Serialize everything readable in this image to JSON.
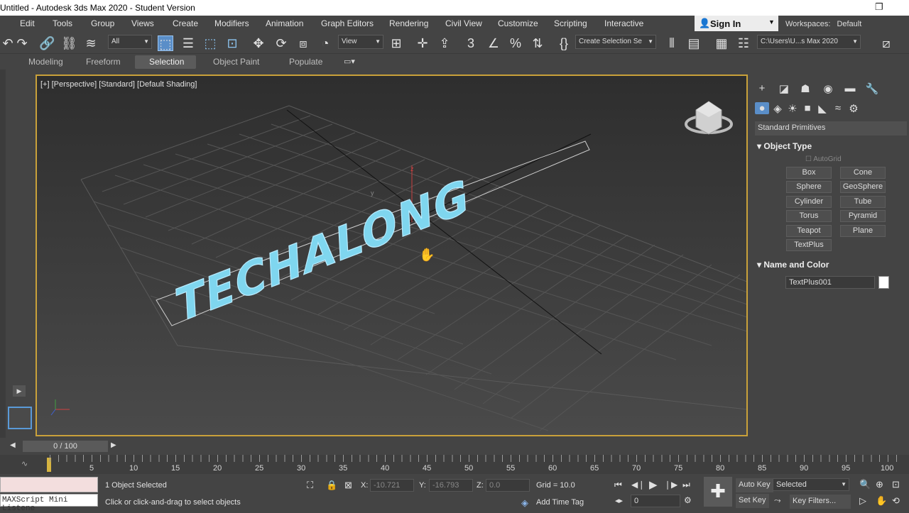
{
  "window": {
    "title": "Untitled - Autodesk 3ds Max 2020 - Student Version"
  },
  "menu": [
    "Edit",
    "Tools",
    "Group",
    "Views",
    "Create",
    "Modifiers",
    "Animation",
    "Graph Editors",
    "Rendering",
    "Civil View",
    "Customize",
    "Scripting",
    "Interactive"
  ],
  "account": {
    "signin": "Sign In",
    "workspaces_label": "Workspaces:",
    "workspace": "Default"
  },
  "toolbar": {
    "filter": "All",
    "ref_coord": "View",
    "selection_set": "Create Selection Se",
    "project_path": "C:\\Users\\U...s Max 2020"
  },
  "ribbon": {
    "tabs": [
      "Modeling",
      "Freeform",
      "Selection",
      "Object Paint",
      "Populate"
    ],
    "active": "Selection"
  },
  "viewport": {
    "label": "[+] [Perspective] [Standard] [Default Shading]",
    "text_object": "TECHALONG",
    "text_color": "#7fd6ef"
  },
  "command_panel": {
    "category": "Standard Primitives",
    "object_type_title": "Object Type",
    "autogrid": "AutoGrid",
    "buttons": [
      "Box",
      "Cone",
      "Sphere",
      "GeoSphere",
      "Cylinder",
      "Tube",
      "Torus",
      "Pyramid",
      "Teapot",
      "Plane",
      "TextPlus"
    ],
    "name_color_title": "Name and Color",
    "object_name": "TextPlus001",
    "object_color": "#ffffff"
  },
  "timeline": {
    "slider": "0 / 100",
    "ticks": [
      "5",
      "10",
      "15",
      "20",
      "25",
      "30",
      "35",
      "40",
      "45",
      "50",
      "55",
      "60",
      "65",
      "70",
      "75",
      "80",
      "85",
      "90",
      "95",
      "100"
    ]
  },
  "status": {
    "maxscript": "MAXScript Mini Listene",
    "selected": "1 Object Selected",
    "prompt": "Click or click-and-drag to select objects",
    "x_label": "X:",
    "x_value": "-10.721",
    "y_label": "Y:",
    "y_value": "-16.793",
    "z_label": "Z:",
    "z_value": "0.0",
    "grid": "Grid = 10.0",
    "add_time_tag": "Add Time Tag",
    "auto_key": "Auto Key",
    "set_key": "Set Key",
    "key_mode": "Selected",
    "key_filters": "Key Filters...",
    "frame": "0"
  }
}
